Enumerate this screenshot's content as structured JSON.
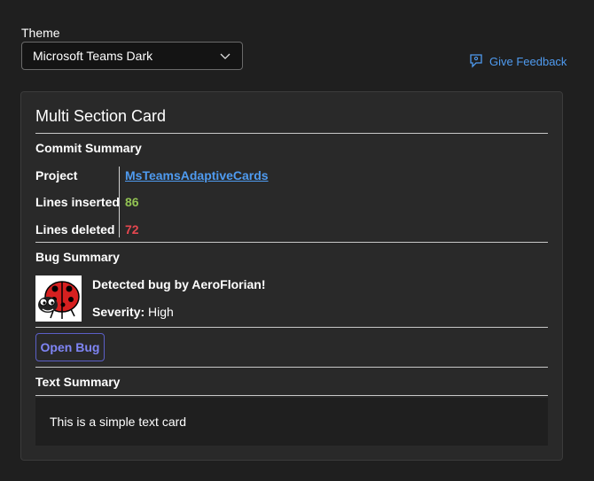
{
  "theme": {
    "label": "Theme",
    "selected": "Microsoft Teams Dark"
  },
  "feedback": {
    "label": "Give Feedback"
  },
  "card": {
    "title": "Multi Section Card",
    "commit": {
      "title": "Commit Summary",
      "facts": [
        {
          "key": "Project",
          "value": "MsTeamsAdaptiveCards"
        },
        {
          "key": "Lines inserted",
          "value": "86"
        },
        {
          "key": "Lines deleted",
          "value": "72"
        }
      ]
    },
    "bug": {
      "title": "Bug Summary",
      "headline": "Detected bug by AeroFlorian!",
      "severity_label": "Severity:",
      "severity_value": "High",
      "button": "Open Bug"
    },
    "text": {
      "title": "Text Summary",
      "body": "This is a simple text card"
    }
  },
  "colors": {
    "link": "#4f9bf0",
    "good": "#92c353",
    "attention": "#e5474f",
    "button_accent": "#7f85f5"
  }
}
